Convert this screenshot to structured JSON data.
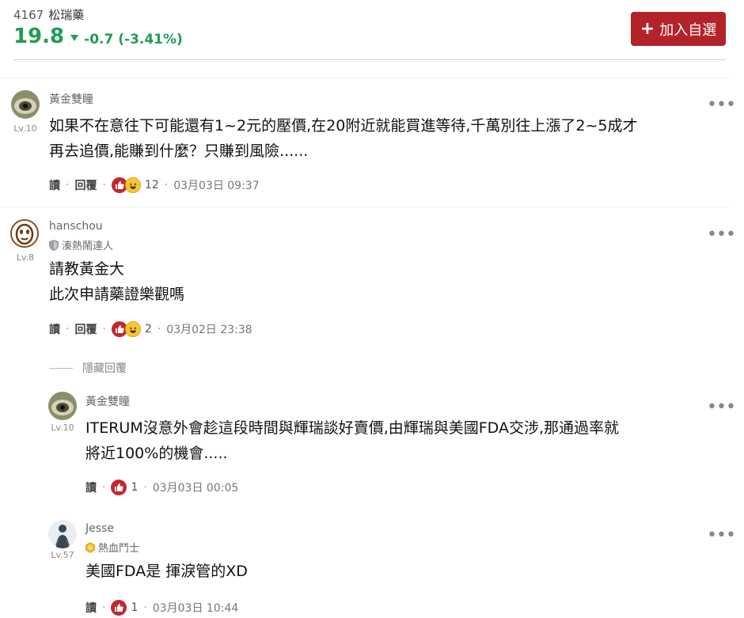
{
  "stock": {
    "code": "4167",
    "name": "松瑞藥",
    "price": "19.8",
    "change": "-0.7 (-3.41%)",
    "add_button": "加入自選",
    "colors": {
      "down": "#1f9d55",
      "button": "#b3232a"
    }
  },
  "actions": {
    "read": "讀",
    "reply": "回覆"
  },
  "hidden_replies": "隱藏回覆",
  "comments": [
    {
      "user": "黃金雙瞳",
      "level": "Lv.10",
      "rank": "",
      "lines": [
        "如果不在意往下可能還有1~2元的壓價,在20附近就能買進等待,千萬別往上漲了2~5成才",
        "再去追價,能賺到什麼？只賺到風險......"
      ],
      "reactions": "12",
      "time": "03月03日 09:37"
    },
    {
      "user": "hanschou",
      "level": "Lv.8",
      "rank": "湊熱鬧達人",
      "lines": [
        "請教黃金大",
        "此次申請藥證樂觀嗎"
      ],
      "reactions": "2",
      "time": "03月02日 23:38"
    },
    {
      "user": "黃金雙瞳",
      "level": "Lv.10",
      "rank": "",
      "lines": [
        "ITERUM沒意外會趁這段時間與輝瑞談好賣價,由輝瑞與美國FDA交涉,那通過率就",
        "將近100%的機會....."
      ],
      "reactions": "1",
      "time": "03月03日 00:05"
    },
    {
      "user": "Jesse",
      "level": "Lv.57",
      "rank": "熱血鬥士",
      "lines": [
        "美國FDA是 揮淚管的XD"
      ],
      "reactions": "1",
      "time": "03月03日 10:44"
    }
  ]
}
